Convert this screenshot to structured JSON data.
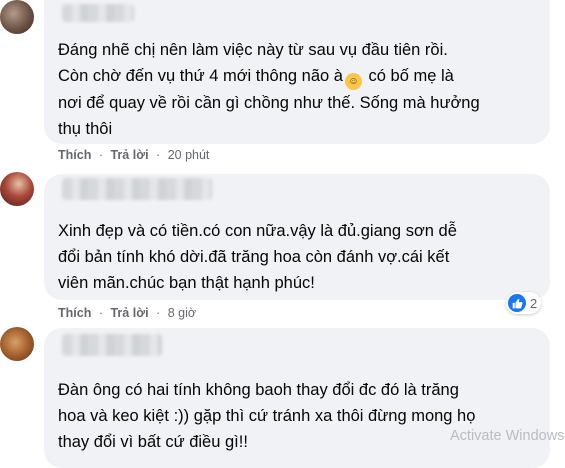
{
  "comments": [
    {
      "text": "Đáng nhẽ chị nên làm việc này từ sau vụ đầu tiên rồi.\nCòn chờ đến vụ thứ 4 mới thông não à",
      "text_after_emoji": " có bố mẹ là\nnơi để quay về rồi cần gì chồng như thế. Sống mà hưởng\nthụ thôi",
      "emoji_icon": "grinning-face-emoji",
      "like_label": "Thích",
      "reply_label": "Trả lời",
      "time": "20 phút"
    },
    {
      "text": "Xinh đẹp và có tiền.có con nữa.vậy là đủ.giang sơn dễ\nđổi bản tính khó dời.đã trăng hoa còn đánh vợ.cái kết\nviên mãn.chúc bạn thật hạnh phúc!",
      "like_label": "Thích",
      "reply_label": "Trả lời",
      "time": "8 giờ",
      "reaction_count": "2",
      "reaction_icon": "like-icon"
    },
    {
      "text": "Đàn ông có hai tính không baoh thay đổi đc đó là trăng\nhoa và keo kiệt :)) gặp thì cứ tránh xa thôi đừng mong họ\nthay đổi vì bất cứ điều gì!!"
    }
  ],
  "separator": "·",
  "watermark": "Activate Windows",
  "colors": {
    "bubble": "#f0f2f5",
    "meta_text": "#65676b",
    "like_blue": "#1877f2"
  }
}
